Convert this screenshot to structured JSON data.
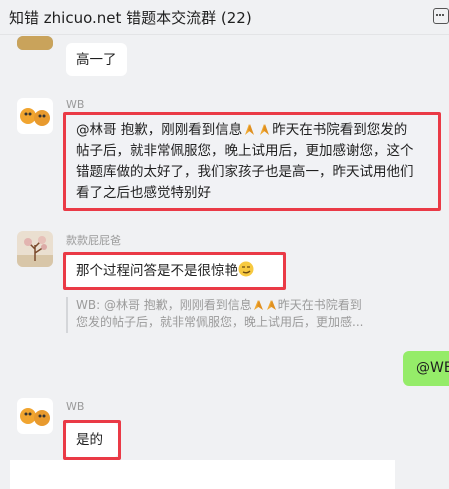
{
  "header": {
    "title": "知错 zhicuo.net 错题本交流群 (22)",
    "more_icon": "chat-more-icon"
  },
  "messages": [
    {
      "text": "高一了"
    },
    {
      "sender": "WB",
      "lines": [
        "@林哥 抱歉，刚刚看到信息",
        "昨天在书院看到您发的",
        "帖子后，就非常佩服您，晚上试用后，更加感谢您，这个",
        "错题库做的太好了，我们家孩子也是高一，昨天试用他们",
        "看了之后也感觉特别好"
      ]
    },
    {
      "sender": "款款屁屁爸",
      "text": "那个过程问答是不是很惊艳",
      "quote": {
        "line1a": "WB: @林哥 抱歉，刚刚看到信息",
        "line1b": "昨天在书院看到",
        "line2": "您发的帖子后，就非常佩服您，晚上试用后，更加感..."
      }
    },
    {
      "text": "@WB"
    },
    {
      "sender": "WB",
      "text": "是的"
    }
  ]
}
